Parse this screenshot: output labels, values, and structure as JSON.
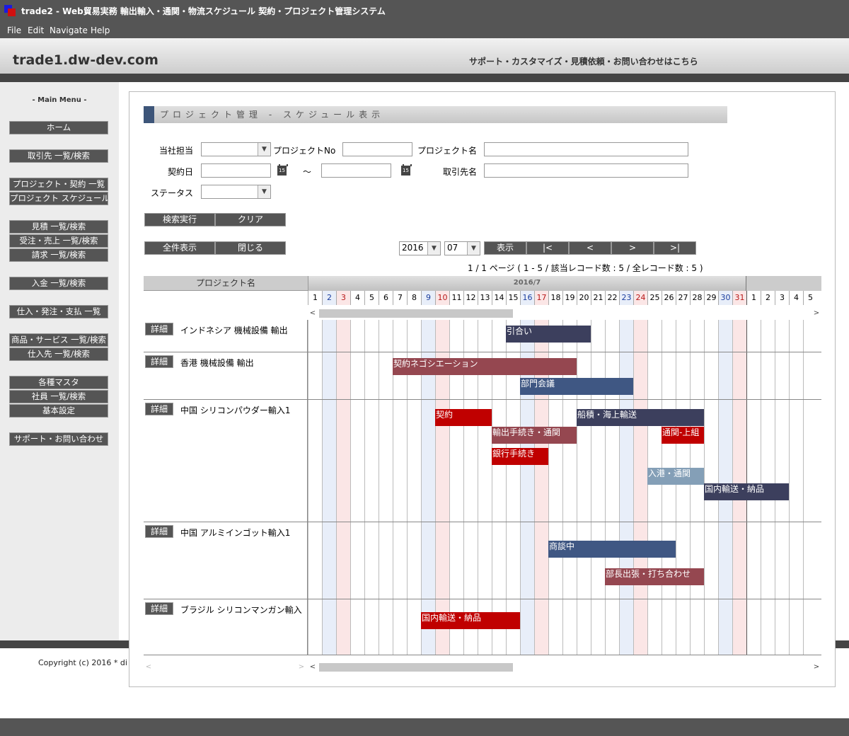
{
  "window": {
    "title": "trade2 - Web貿易実務 輸出輸入・通関・物流スケジュール 契約・プロジェクト管理システム"
  },
  "menu": [
    "File",
    "Edit",
    "Navigate",
    "Help"
  ],
  "header": {
    "site_name": "trade1.dw-dev.com",
    "support_link": "サポート・カスタマイズ・見積依頼・お問い合わせはこちら"
  },
  "sidebar": {
    "title": "- Main Menu -",
    "items": [
      "ホーム",
      "取引先 一覧/検索",
      "プロジェクト・契約 一覧",
      "プロジェクト スケジュール",
      "見積 一覧/検索",
      "受注・売上 一覧/検索",
      "請求 一覧/検索",
      "入金 一覧/検索",
      "仕入・発注・支払 一覧",
      "商品・サービス 一覧/検索",
      "仕入先 一覧/検索",
      "各種マスタ",
      "社員 一覧/検索",
      "基本設定",
      "サポート・お問い合わせ"
    ]
  },
  "footer": {
    "copyright": "Copyright (c) 2016 * di"
  },
  "page": {
    "title": "プロジェクト管理 - スケジュール表示"
  },
  "form": {
    "staff_label": "当社担当",
    "project_no_label": "プロジェクトNo",
    "project_name_label": "プロジェクト名",
    "contract_date_label": "契約日",
    "tilde": "～",
    "client_name_label": "取引先名",
    "status_label": "ステータス",
    "calendar_icon_text": "15"
  },
  "buttons": {
    "search": "検索実行",
    "clear": "クリア",
    "show_all": "全件表示",
    "close": "閉じる",
    "display": "表示",
    "first": "|<",
    "prev": "<",
    "next": ">",
    "last": ">|"
  },
  "period": {
    "year": "2016",
    "month": "07"
  },
  "pager": {
    "info": "1 / 1 ページ ( 1 - 5 / 該当レコード数 : 5 / 全レコード数 : 5 )"
  },
  "gantt": {
    "name_header": "プロジェクト名",
    "month_header": "2016/7",
    "detail_label": "詳細",
    "days": [
      {
        "d": "1",
        "t": "w"
      },
      {
        "d": "2",
        "t": "sat"
      },
      {
        "d": "3",
        "t": "sun"
      },
      {
        "d": "4",
        "t": "w"
      },
      {
        "d": "5",
        "t": "w"
      },
      {
        "d": "6",
        "t": "w"
      },
      {
        "d": "7",
        "t": "w"
      },
      {
        "d": "8",
        "t": "w"
      },
      {
        "d": "9",
        "t": "sat"
      },
      {
        "d": "10",
        "t": "sun"
      },
      {
        "d": "11",
        "t": "w"
      },
      {
        "d": "12",
        "t": "w"
      },
      {
        "d": "13",
        "t": "w"
      },
      {
        "d": "14",
        "t": "w"
      },
      {
        "d": "15",
        "t": "w"
      },
      {
        "d": "16",
        "t": "sat"
      },
      {
        "d": "17",
        "t": "sun"
      },
      {
        "d": "18",
        "t": "w"
      },
      {
        "d": "19",
        "t": "w"
      },
      {
        "d": "20",
        "t": "w"
      },
      {
        "d": "21",
        "t": "w"
      },
      {
        "d": "22",
        "t": "w"
      },
      {
        "d": "23",
        "t": "sat"
      },
      {
        "d": "24",
        "t": "sun"
      },
      {
        "d": "25",
        "t": "w"
      },
      {
        "d": "26",
        "t": "w"
      },
      {
        "d": "27",
        "t": "w"
      },
      {
        "d": "28",
        "t": "w"
      },
      {
        "d": "29",
        "t": "w"
      },
      {
        "d": "30",
        "t": "sat"
      },
      {
        "d": "31",
        "t": "sun"
      },
      {
        "d": "1",
        "t": "w"
      },
      {
        "d": "2",
        "t": "w"
      },
      {
        "d": "3",
        "t": "w"
      },
      {
        "d": "4",
        "t": "w"
      },
      {
        "d": "5",
        "t": "w"
      }
    ],
    "rows": [
      {
        "name": "インドネシア 機械設備 輸出",
        "tasks": [
          {
            "label": "引合い",
            "start": 15,
            "end": 20,
            "lane": 0,
            "color": "navy"
          }
        ]
      },
      {
        "name": "香港 機械設備 輸出",
        "tasks": [
          {
            "label": "契約ネゴシエーション",
            "start": 7,
            "end": 19,
            "lane": 0,
            "color": "wine"
          },
          {
            "label": "部門会議",
            "start": 16,
            "end": 23,
            "lane": 1,
            "color": "blue"
          }
        ]
      },
      {
        "name": "中国 シリコンパウダー輸入1",
        "tasks": [
          {
            "label": "契約",
            "start": 10,
            "end": 13,
            "lane": 0,
            "color": "red"
          },
          {
            "label": "船積・海上輸送",
            "start": 20,
            "end": 28,
            "lane": 0,
            "color": "navy"
          },
          {
            "label": "輸出手続き・通関",
            "start": 14,
            "end": 19,
            "lane": 1,
            "color": "wine"
          },
          {
            "label": "通関-上組",
            "start": 26,
            "end": 28,
            "lane": 1,
            "color": "red"
          },
          {
            "label": "銀行手続き",
            "start": 14,
            "end": 17,
            "lane": 2,
            "color": "red"
          },
          {
            "label": "入港・通関",
            "start": 25,
            "end": 28,
            "lane": 3,
            "color": "lightblue"
          },
          {
            "label": "国内輸送・納品",
            "start": 29,
            "end": 34,
            "lane": 4,
            "color": "navy"
          }
        ]
      },
      {
        "name": "中国 アルミインゴット輸入1",
        "tasks": [
          {
            "label": "商談中",
            "start": 18,
            "end": 26,
            "lane": 0,
            "color": "blue"
          },
          {
            "label": "部長出張・打ち合わせ",
            "start": 22,
            "end": 28,
            "lane": 1,
            "color": "wine"
          }
        ]
      },
      {
        "name": "ブラジル シリコンマンガン輸入",
        "tasks": [
          {
            "label": "国内輸送・納品",
            "start": 9,
            "end": 15,
            "lane": 0,
            "color": "red"
          }
        ]
      }
    ]
  }
}
